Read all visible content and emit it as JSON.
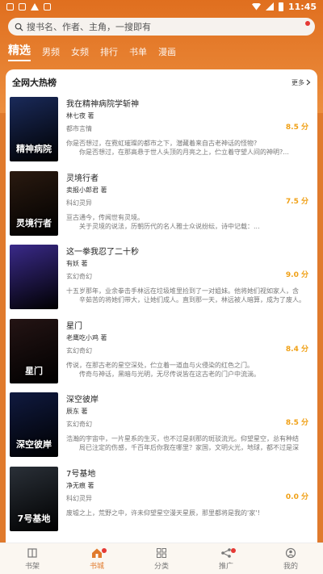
{
  "status": {
    "time": "11:45"
  },
  "search": {
    "placeholder": "搜书名、作者、主角，一搜即有"
  },
  "tabs": [
    {
      "label": "精选"
    },
    {
      "label": "男频"
    },
    {
      "label": "女频"
    },
    {
      "label": "排行"
    },
    {
      "label": "书单"
    },
    {
      "label": "漫画"
    }
  ],
  "section": {
    "title": "全网大热榜",
    "more": "更多"
  },
  "books": [
    {
      "title": "我在精神病院学斩神",
      "author": "林七夜 著",
      "category": "都市言情",
      "score": "8.5 分",
      "desc1": "你是否想过，在霓虹璀璨的都市之下，潜藏着来自古老神话的怪物?",
      "desc2": "你是否想过，在那高悬于世人头顶的月亮之上，伫立着守望人间的神明?...",
      "cover_text": "精神病院",
      "cover_color": "#1a2a5a"
    },
    {
      "title": "灵境行者",
      "author": "卖报小郎君 著",
      "category": "科幻灵异",
      "score": "7.5 分",
      "desc1": "亘古通今，传闻世有灵境。",
      "desc2": "关于灵境的说法，历朝历代的名人雅士众说纷纭，诗中记载：...",
      "cover_text": "灵境行者",
      "cover_color": "#2a1a10"
    },
    {
      "title": "这一拳我忍了二十秒",
      "author": "有妖 著",
      "category": "玄幻奇幻",
      "score": "9.0 分",
      "desc1": "十五岁那年，业余拳击手林远在垃圾堆里捡到了一对姐妹。他将她们视如家人，含",
      "desc2": "辛茹苦的将她们带大，让她们成人。直到那一天，林远被人暗算，成为了废人。",
      "cover_text": "",
      "cover_color": "#3a2a8a"
    },
    {
      "title": "星门",
      "author": "老鹰吃小鸡 著",
      "category": "玄幻奇幻",
      "score": "8.4 分",
      "desc1": "传说，在那古老的星空深处，伫立着一道血与火侵染的红色之门。",
      "desc2": "传奇与神话，黑暗与光明，无尽传说皆在这古老的门户中流淌。",
      "cover_text": "星门",
      "cover_color": "#241414"
    },
    {
      "title": "深空彼岸",
      "author": "辰东 著",
      "category": "玄幻奇幻",
      "score": "8.5 分",
      "desc1": "浩瀚的宇宙中，一片星系的生灭，也不过是刹那的斑驳流光。仰望星空，总有种结",
      "desc2": "局已注定的伤感，千百年后你我在哪里？家国，文明火光，地球，都不过是深空...",
      "cover_text": "深空彼岸",
      "cover_color": "#101a40"
    },
    {
      "title": "7号基地",
      "author": "净无痕 著",
      "category": "科幻灵异",
      "score": "0.0 分",
      "desc1": "废墟之上，荒野之中，许未仰望星空漫天星辰，那里都将是我的'家'！",
      "desc2": "",
      "cover_text": "7号基地",
      "cover_color": "#2a3038"
    }
  ],
  "nav": [
    {
      "label": "书架",
      "icon": "bookshelf-icon"
    },
    {
      "label": "书城",
      "icon": "home-icon"
    },
    {
      "label": "分类",
      "icon": "grid-icon"
    },
    {
      "label": "推广",
      "icon": "share-icon"
    },
    {
      "label": "我的",
      "icon": "user-icon"
    }
  ]
}
